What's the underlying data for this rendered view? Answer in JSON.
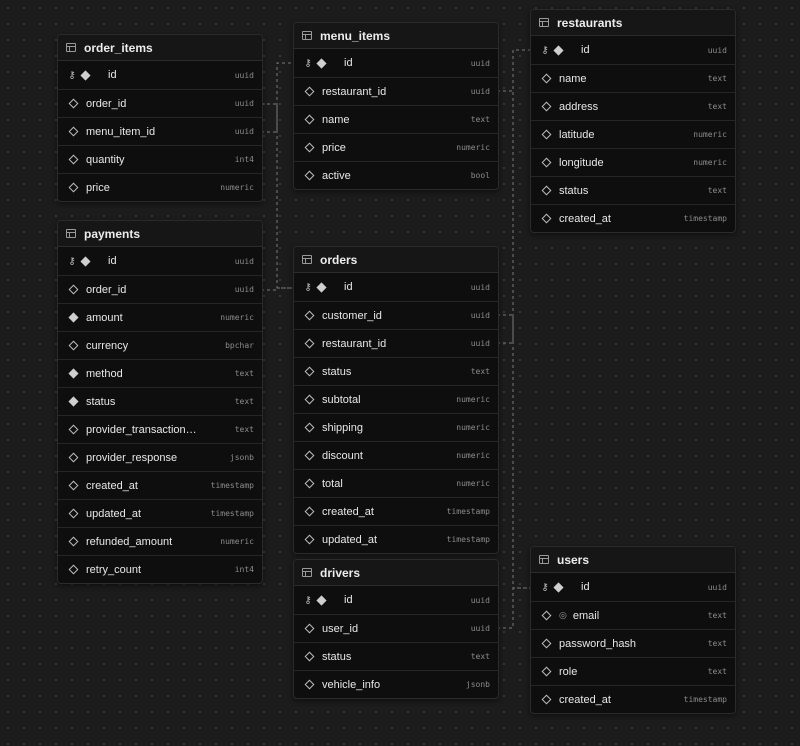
{
  "tables": {
    "order_items": {
      "name": "order_items",
      "columns": [
        {
          "name": "id",
          "type": "uuid",
          "pk": true
        },
        {
          "name": "order_id",
          "type": "uuid"
        },
        {
          "name": "menu_item_id",
          "type": "uuid"
        },
        {
          "name": "quantity",
          "type": "int4"
        },
        {
          "name": "price",
          "type": "numeric"
        }
      ]
    },
    "payments": {
      "name": "payments",
      "columns": [
        {
          "name": "id",
          "type": "uuid",
          "pk": true
        },
        {
          "name": "order_id",
          "type": "uuid"
        },
        {
          "name": "amount",
          "type": "numeric",
          "required": true
        },
        {
          "name": "currency",
          "type": "bpchar"
        },
        {
          "name": "method",
          "type": "text",
          "required": true
        },
        {
          "name": "status",
          "type": "text",
          "required": true
        },
        {
          "name": "provider_transaction…",
          "type": "text"
        },
        {
          "name": "provider_response",
          "type": "jsonb"
        },
        {
          "name": "created_at",
          "type": "timestamp"
        },
        {
          "name": "updated_at",
          "type": "timestamp"
        },
        {
          "name": "refunded_amount",
          "type": "numeric"
        },
        {
          "name": "retry_count",
          "type": "int4"
        }
      ]
    },
    "menu_items": {
      "name": "menu_items",
      "columns": [
        {
          "name": "id",
          "type": "uuid",
          "pk": true
        },
        {
          "name": "restaurant_id",
          "type": "uuid"
        },
        {
          "name": "name",
          "type": "text"
        },
        {
          "name": "price",
          "type": "numeric"
        },
        {
          "name": "active",
          "type": "bool"
        }
      ]
    },
    "orders": {
      "name": "orders",
      "columns": [
        {
          "name": "id",
          "type": "uuid",
          "pk": true
        },
        {
          "name": "customer_id",
          "type": "uuid"
        },
        {
          "name": "restaurant_id",
          "type": "uuid"
        },
        {
          "name": "status",
          "type": "text"
        },
        {
          "name": "subtotal",
          "type": "numeric"
        },
        {
          "name": "shipping",
          "type": "numeric"
        },
        {
          "name": "discount",
          "type": "numeric"
        },
        {
          "name": "total",
          "type": "numeric"
        },
        {
          "name": "created_at",
          "type": "timestamp"
        },
        {
          "name": "updated_at",
          "type": "timestamp"
        }
      ]
    },
    "drivers": {
      "name": "drivers",
      "columns": [
        {
          "name": "id",
          "type": "uuid",
          "pk": true
        },
        {
          "name": "user_id",
          "type": "uuid"
        },
        {
          "name": "status",
          "type": "text"
        },
        {
          "name": "vehicle_info",
          "type": "jsonb"
        }
      ]
    },
    "restaurants": {
      "name": "restaurants",
      "columns": [
        {
          "name": "id",
          "type": "uuid",
          "pk": true
        },
        {
          "name": "name",
          "type": "text"
        },
        {
          "name": "address",
          "type": "text"
        },
        {
          "name": "latitude",
          "type": "numeric"
        },
        {
          "name": "longitude",
          "type": "numeric"
        },
        {
          "name": "status",
          "type": "text"
        },
        {
          "name": "created_at",
          "type": "timestamp"
        }
      ]
    },
    "users": {
      "name": "users",
      "columns": [
        {
          "name": "id",
          "type": "uuid",
          "pk": true
        },
        {
          "name": "email",
          "type": "text",
          "unique": true
        },
        {
          "name": "password_hash",
          "type": "text"
        },
        {
          "name": "role",
          "type": "text"
        },
        {
          "name": "created_at",
          "type": "timestamp"
        }
      ]
    }
  },
  "icons": {
    "table": "table-icon",
    "primary_key": "key-icon",
    "unique": "fingerprint-icon",
    "nullable": "hollow-diamond-icon",
    "not_null": "filled-diamond-icon"
  },
  "colors": {
    "canvas": "#1c1c1c",
    "table_body": "#0e0e0e",
    "table_header": "#161616",
    "connector": "#7a7a7a"
  },
  "glyphs": {
    "key": "⚷",
    "unique": "◎"
  }
}
